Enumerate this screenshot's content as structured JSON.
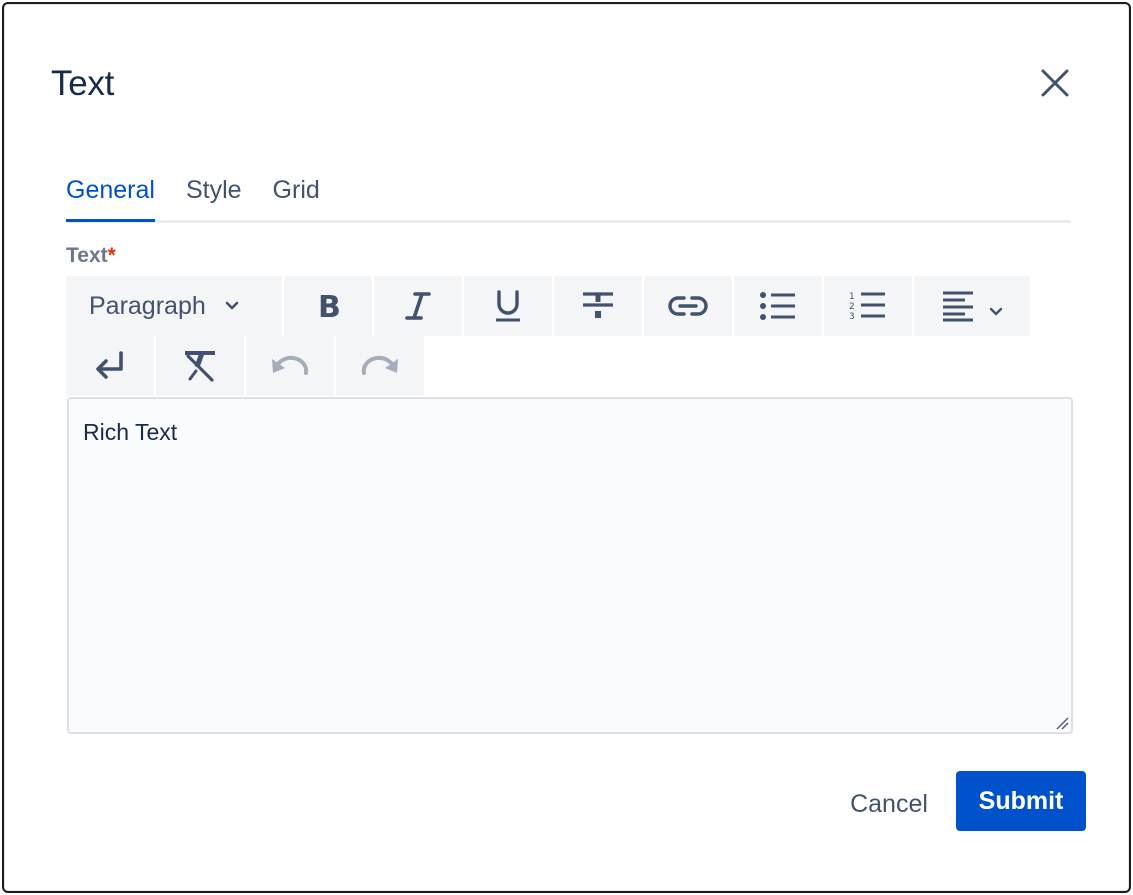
{
  "dialog": {
    "title": "Text",
    "close_icon": "close-icon"
  },
  "tabs": [
    {
      "label": "General",
      "active": true
    },
    {
      "label": "Style",
      "active": false
    },
    {
      "label": "Grid",
      "active": false
    }
  ],
  "field": {
    "label": "Text",
    "required_mark": "*",
    "value": "Rich Text"
  },
  "toolbar": {
    "block_format": "Paragraph",
    "buttons_row1": [
      "bold-icon",
      "italic-icon",
      "underline-icon",
      "strikethrough-icon",
      "link-icon",
      "bullet-list-icon",
      "numbered-list-icon",
      "align-left-icon"
    ],
    "buttons_row2": [
      "line-break-icon",
      "clear-formatting-icon",
      "undo-icon",
      "redo-icon"
    ],
    "disabled": [
      "undo-icon",
      "redo-icon"
    ]
  },
  "footer": {
    "cancel_label": "Cancel",
    "submit_label": "Submit"
  },
  "colors": {
    "primary": "#0052cc",
    "text": "#172b4d",
    "subtle_text": "#42526e",
    "required": "#de350b"
  }
}
